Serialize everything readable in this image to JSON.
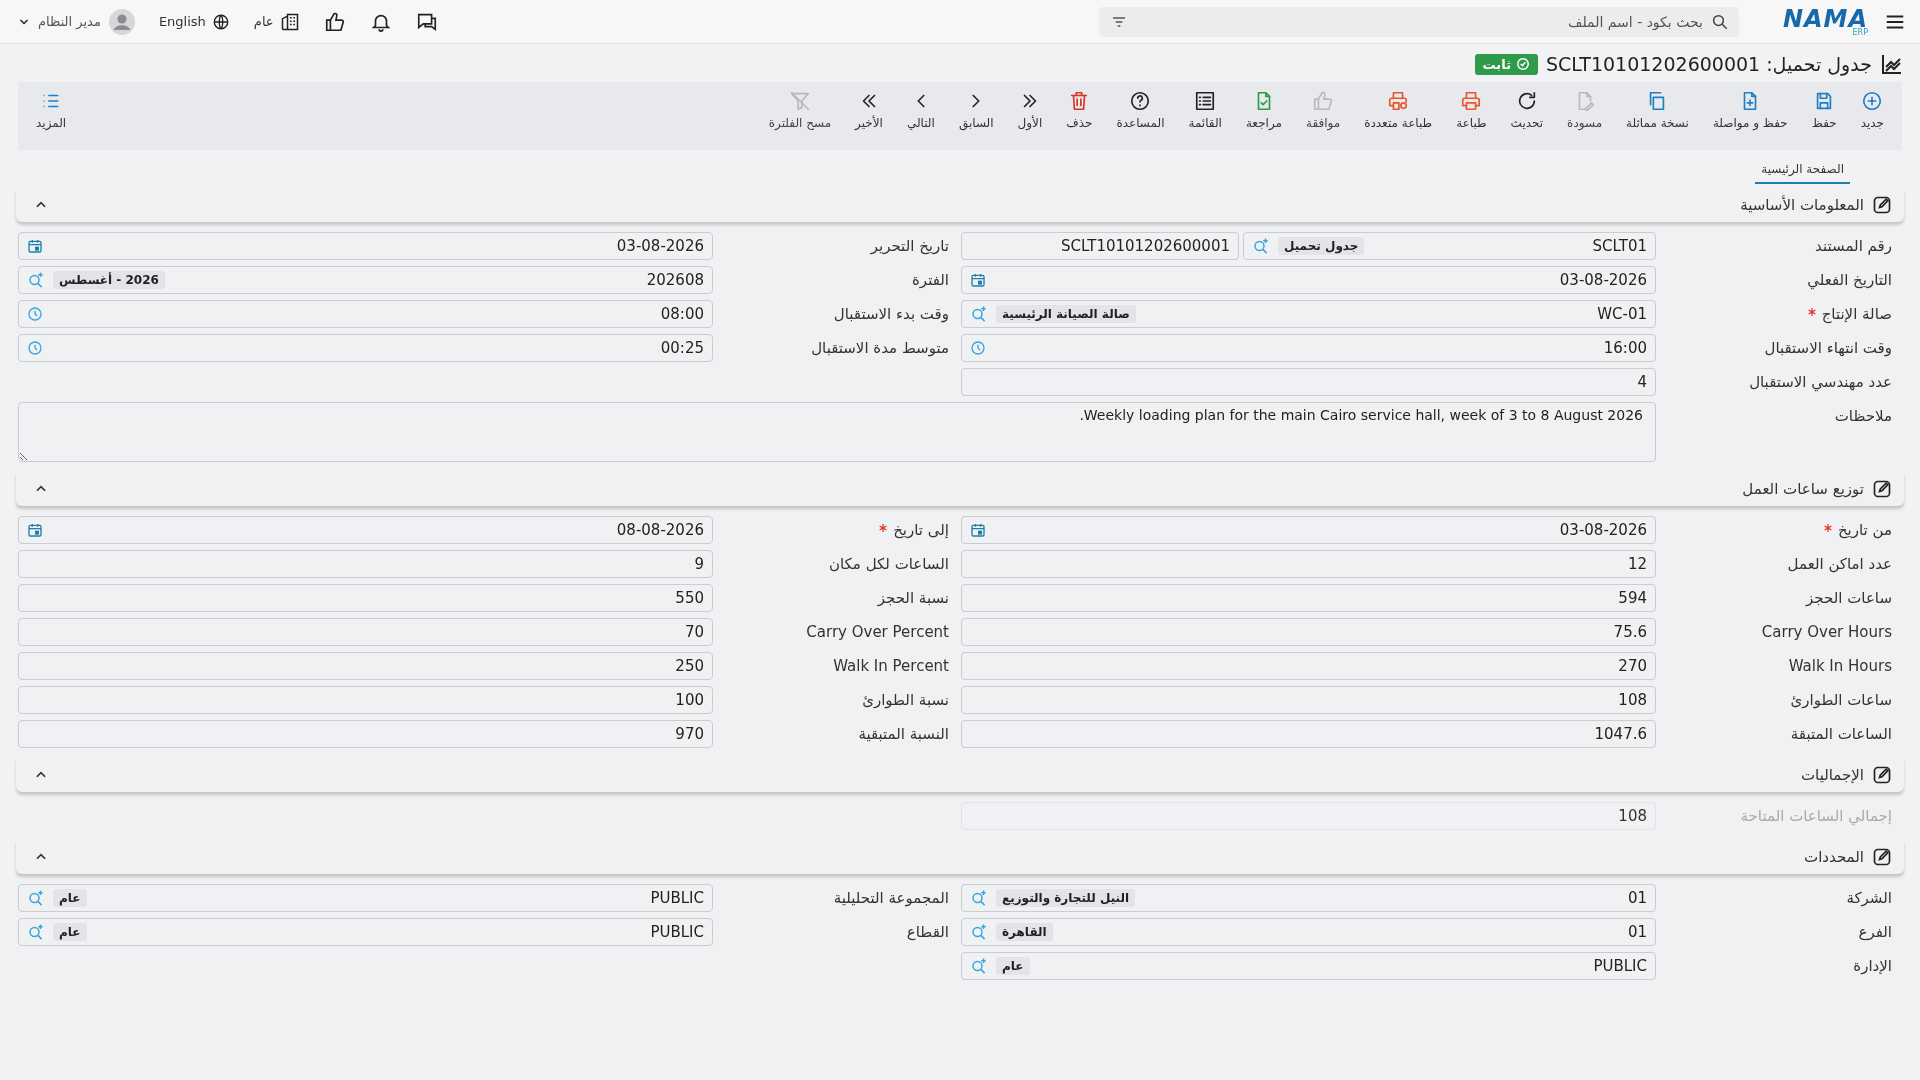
{
  "topbar": {
    "logo": "NAMA",
    "logo_sub": "ERP",
    "search": {
      "placeholder": "بحث بكود - اسم الملف"
    },
    "scope": "عام",
    "language": "English",
    "user": "مدير النظام"
  },
  "title": {
    "text": "جدول تحميل: SCLT10101202600001",
    "status": "ثابت"
  },
  "toolbar": [
    {
      "label": "جديد",
      "kind": "new",
      "disabled": false
    },
    {
      "label": "حفظ",
      "kind": "save",
      "disabled": false
    },
    {
      "label": "حفظ و مواصلة",
      "kind": "save-continue",
      "disabled": false
    },
    {
      "label": "نسخة مماثلة",
      "kind": "copy",
      "disabled": false
    },
    {
      "label": "مسودة",
      "kind": "draft",
      "disabled": true
    },
    {
      "label": "تحديث",
      "kind": "refresh",
      "disabled": false
    },
    {
      "label": "طباعة",
      "kind": "print",
      "disabled": false
    },
    {
      "label": "طباعة متعددة",
      "kind": "print-multi",
      "disabled": false
    },
    {
      "label": "موافقة",
      "kind": "approve",
      "disabled": true
    },
    {
      "label": "مراجعة",
      "kind": "review",
      "disabled": false
    },
    {
      "label": "القائمة",
      "kind": "list",
      "disabled": false
    },
    {
      "label": "المساعدة",
      "kind": "help",
      "disabled": false
    },
    {
      "label": "حذف",
      "kind": "delete",
      "disabled": false
    },
    {
      "label": "الأول",
      "kind": "first",
      "disabled": false
    },
    {
      "label": "السابق",
      "kind": "prev",
      "disabled": false
    },
    {
      "label": "التالي",
      "kind": "next",
      "disabled": false
    },
    {
      "label": "الأخير",
      "kind": "last",
      "disabled": false
    },
    {
      "label": "مسح الفلترة",
      "kind": "clear-filter",
      "disabled": true
    }
  ],
  "more": "المزيد",
  "tabs": [
    {
      "label": "الصفحة الرئيسية",
      "selected": true
    }
  ],
  "sections": [
    {
      "title": "المعلومات الأساسية",
      "expanded": true,
      "rows": [
        [
          {
            "label": "رقم المستند",
            "kind": "doc",
            "value": "SCLT01",
            "chip": "جدول تحميل",
            "number": "SCLT10101202600001",
            "required": false,
            "disabled": false
          },
          {
            "label": "تاريخ التحرير",
            "kind": "date",
            "value": "03-08-2026",
            "required": false,
            "disabled": false
          }
        ],
        [
          {
            "label": "التاريخ الفعلي",
            "kind": "date",
            "value": "03-08-2026",
            "required": false,
            "disabled": false
          },
          {
            "label": "الفترة",
            "kind": "lookup",
            "value": "202608",
            "chip": "2026 - أغسطس",
            "required": false,
            "disabled": false
          }
        ],
        [
          {
            "label": "صالة الإنتاج",
            "kind": "lookup",
            "value": "WC-01",
            "chip": "صالة الصيانة الرئيسية",
            "required": true,
            "disabled": false
          },
          {
            "label": "وقت بدء الاستقبال",
            "kind": "time",
            "value": "08:00",
            "required": false,
            "disabled": false
          }
        ],
        [
          {
            "label": "وقت انتهاء الاستقبال",
            "kind": "time",
            "value": "16:00",
            "required": false,
            "disabled": false
          },
          {
            "label": "متوسط مدة الاستقبال",
            "kind": "time",
            "value": "00:25",
            "required": false,
            "disabled": false
          }
        ],
        [
          {
            "label": "عدد مهندسي الاستقبال",
            "kind": "text",
            "value": "4",
            "required": false,
            "disabled": false
          }
        ],
        [
          {
            "label": "ملاحظات",
            "kind": "textarea",
            "value": "Weekly loading plan for the main Cairo service hall, week of 3 to 8 August 2026.",
            "required": false,
            "disabled": false
          }
        ]
      ]
    },
    {
      "title": "توزيع ساعات العمل",
      "expanded": true,
      "rows": [
        [
          {
            "label": "من تاريخ",
            "kind": "date",
            "value": "03-08-2026",
            "required": true,
            "disabled": false
          },
          {
            "label": "إلى تاريخ",
            "kind": "date",
            "value": "08-08-2026",
            "required": true,
            "disabled": false
          }
        ],
        [
          {
            "label": "عدد اماكن العمل",
            "kind": "text",
            "value": "12",
            "required": false,
            "disabled": false
          },
          {
            "label": "الساعات لكل مكان",
            "kind": "text",
            "value": "9",
            "required": false,
            "disabled": false
          }
        ],
        [
          {
            "label": "ساعات الحجز",
            "kind": "text",
            "value": "594",
            "required": false,
            "disabled": false
          },
          {
            "label": "نسبة الحجز",
            "kind": "text",
            "value": "550",
            "required": false,
            "disabled": false
          }
        ],
        [
          {
            "label": "Carry Over Hours",
            "kind": "text",
            "value": "75.6",
            "required": false,
            "disabled": false
          },
          {
            "label": "Carry Over Percent",
            "kind": "text",
            "value": "70",
            "required": false,
            "disabled": false
          }
        ],
        [
          {
            "label": "Walk In Hours",
            "kind": "text",
            "value": "270",
            "required": false,
            "disabled": false
          },
          {
            "label": "Walk In Percent",
            "kind": "text",
            "value": "250",
            "required": false,
            "disabled": false
          }
        ],
        [
          {
            "label": "ساعات الطوارئ",
            "kind": "text",
            "value": "108",
            "required": false,
            "disabled": false
          },
          {
            "label": "نسبة الطوارئ",
            "kind": "text",
            "value": "100",
            "required": false,
            "disabled": false
          }
        ],
        [
          {
            "label": "الساعات المتبقة",
            "kind": "text",
            "value": "1047.6",
            "required": false,
            "disabled": false
          },
          {
            "label": "النسبة المتبقية",
            "kind": "text",
            "value": "970",
            "required": false,
            "disabled": false
          }
        ]
      ]
    },
    {
      "title": "الإجماليات",
      "expanded": true,
      "rows": [
        [
          {
            "label": "إجمالي الساعات المتاحة",
            "kind": "text",
            "value": "108",
            "required": false,
            "disabled": true
          }
        ]
      ]
    },
    {
      "title": "المحددات",
      "expanded": true,
      "rows": [
        [
          {
            "label": "الشركة",
            "kind": "lookup",
            "value": "01",
            "chip": "النيل للتجارة والتوزيع",
            "required": false,
            "disabled": false
          },
          {
            "label": "المجموعة التحليلية",
            "kind": "lookup",
            "value": "PUBLIC",
            "chip": "عام",
            "required": false,
            "disabled": false
          }
        ],
        [
          {
            "label": "الفرع",
            "kind": "lookup",
            "value": "01",
            "chip": "القاهرة",
            "required": false,
            "disabled": false
          },
          {
            "label": "القطاع",
            "kind": "lookup",
            "value": "PUBLIC",
            "chip": "عام",
            "required": false,
            "disabled": false
          }
        ],
        [
          {
            "label": "الإدارة",
            "kind": "lookup",
            "value": "PUBLIC",
            "chip": "عام",
            "required": false,
            "disabled": false
          }
        ]
      ]
    }
  ]
}
